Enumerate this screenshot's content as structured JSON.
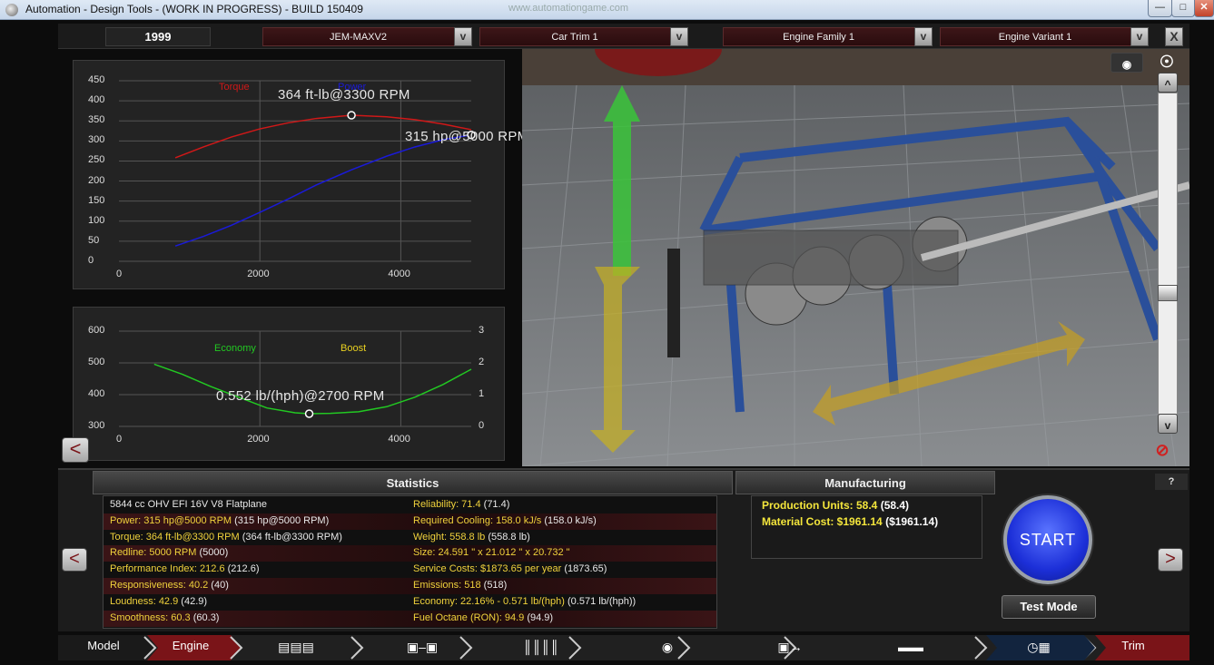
{
  "window": {
    "title": "Automation - Design Tools - (WORK IN PROGRESS) - BUILD 150409",
    "ghost_tab": "www.automationgame.com"
  },
  "top": {
    "year": "1999",
    "model_select": "JEM-MAXV2",
    "trim_select": "Car Trim 1",
    "family_select": "Engine Family 1",
    "variant_select": "Engine Variant 1",
    "arrow": "v",
    "close": "X"
  },
  "torque_chart": {
    "type": "line",
    "series_labels": {
      "torque": "Torque",
      "power": "Power"
    },
    "y_ticks": [
      "450",
      "400",
      "350",
      "300",
      "250",
      "200",
      "150",
      "100",
      "50",
      "0"
    ],
    "x_ticks": [
      "0",
      "2000",
      "4000"
    ],
    "xlim": [
      0,
      5000
    ],
    "ylim": [
      0,
      450
    ],
    "torque_peak_label": "364 ft-lb@3300 RPM",
    "power_peak_label": "315 hp@5000 RPM",
    "series": [
      {
        "name": "Torque",
        "color": "#d01818",
        "x": [
          800,
          1200,
          1600,
          2000,
          2400,
          2800,
          3300,
          3800,
          4200,
          4600,
          5000
        ],
        "y": [
          258,
          285,
          310,
          330,
          345,
          356,
          364,
          360,
          353,
          342,
          328
        ]
      },
      {
        "name": "Power",
        "color": "#1a1ad8",
        "x": [
          800,
          1200,
          1600,
          2000,
          2400,
          2800,
          3300,
          3800,
          4200,
          4600,
          5000
        ],
        "y": [
          38,
          62,
          90,
          122,
          155,
          190,
          228,
          262,
          285,
          303,
          315
        ]
      }
    ]
  },
  "economy_chart": {
    "type": "line",
    "series_labels": {
      "economy": "Economy",
      "boost": "Boost"
    },
    "y_ticks_left": [
      "600",
      "500",
      "400",
      "300"
    ],
    "y_ticks_right": [
      "3",
      "2",
      "1",
      "0"
    ],
    "x_ticks": [
      "0",
      "2000",
      "4000"
    ],
    "xlim": [
      0,
      5000
    ],
    "ylim": [
      300,
      600
    ],
    "peak_label": "0.552 lb/(hph)@2700 RPM",
    "series": [
      {
        "name": "Economy",
        "color": "#22c822",
        "x": [
          500,
          900,
          1300,
          1700,
          2100,
          2500,
          2700,
          3000,
          3400,
          3800,
          4200,
          4600,
          5000
        ],
        "y": [
          496,
          464,
          426,
          392,
          358,
          343,
          340,
          341,
          346,
          362,
          392,
          432,
          480
        ]
      }
    ]
  },
  "statistics": {
    "header": "Statistics",
    "left": [
      {
        "label": "5844 cc OHV EFI 16V V8 Flatplane",
        "value": ""
      },
      {
        "label": "Power: 315 hp@5000 RPM",
        "value": "(315 hp@5000 RPM)"
      },
      {
        "label": "Torque: 364 ft-lb@3300 RPM",
        "value": "(364 ft-lb@3300 RPM)"
      },
      {
        "label": "Redline: 5000 RPM",
        "value": "(5000)"
      },
      {
        "label": "Performance Index: 212.6",
        "value": "(212.6)"
      },
      {
        "label": "Responsiveness: 40.2",
        "value": "(40)"
      },
      {
        "label": "Loudness: 42.9",
        "value": "(42.9)"
      },
      {
        "label": "Smoothness: 60.3",
        "value": "(60.3)"
      }
    ],
    "right": [
      {
        "label": "Reliability: 71.4",
        "value": "(71.4)"
      },
      {
        "label": "Required Cooling: 158.0 kJ/s",
        "value": "(158.0 kJ/s)"
      },
      {
        "label": "Weight: 558.8 lb",
        "value": "(558.8 lb)"
      },
      {
        "label": "Size: 24.591 \" x 21.012 \" x 20.732 \"",
        "value": ""
      },
      {
        "label": "Service Costs: $1873.65 per year",
        "value": "(1873.65)"
      },
      {
        "label": "Emissions: 518",
        "value": "(518)"
      },
      {
        "label": "Economy: 22.16% - 0.571 lb/(hph)",
        "value": "(0.571 lb/(hph))"
      },
      {
        "label": "Fuel Octane (RON): 94.9",
        "value": "(94.9)"
      }
    ]
  },
  "manufacturing": {
    "header": "Manufacturing",
    "rows": [
      {
        "label": "Production Units: 58.4",
        "value": "(58.4)"
      },
      {
        "label": "Material Cost: $1961.14",
        "value": "($1961.14)"
      }
    ]
  },
  "controls": {
    "start": "START",
    "test_mode": "Test Mode",
    "help": "?",
    "prev": "<",
    "next": ">",
    "up": "^",
    "down": "v"
  },
  "nav": {
    "model": "Model",
    "engine": "Engine",
    "trim": "Trim"
  }
}
